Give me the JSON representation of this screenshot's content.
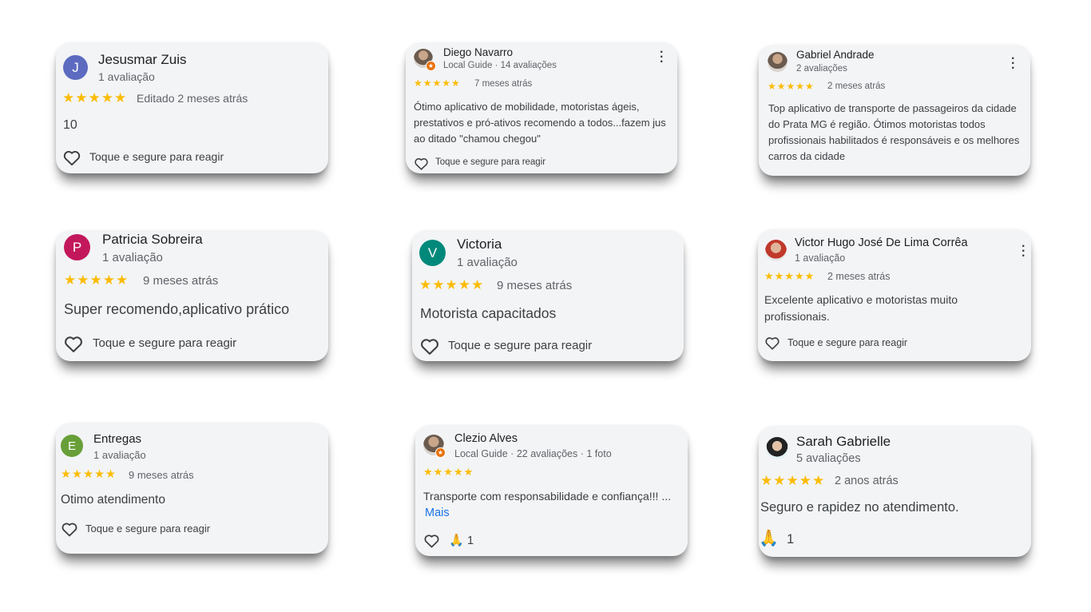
{
  "reaction_hint": "Toque e segure para reagir",
  "reviews": [
    {
      "avatar_letter": "J",
      "avatar_color": "#5c6bc0",
      "name": "Jesusmar Zuis",
      "meta": "1 avaliação",
      "stars": "★★★★★",
      "date": "Editado 2 meses atrás",
      "text": "10"
    },
    {
      "name": "Diego Navarro",
      "meta": "Local Guide · 14 avaliações",
      "stars": "★★★★★",
      "date": "7 meses atrás",
      "text": "Ótimo aplicativo de mobilidade, motoristas ágeis, prestativos e pró-ativos recomendo a todos...fazem jus ao ditado \"chamou chegou\"",
      "menu_icon": "more-vert-icon"
    },
    {
      "name": "Gabriel Andrade",
      "meta": "2 avaliações",
      "stars": "★★★★★",
      "date": "2 meses atrás",
      "text": "Top aplicativo de transporte de passageiros da cidade do Prata MG é região. Ótimos motoristas todos profissionais habilitados é responsáveis e os melhores carros da cidade",
      "menu_icon": "more-vert-icon"
    },
    {
      "avatar_letter": "P",
      "avatar_color": "#c2185b",
      "name": "Patricia Sobreira",
      "meta": "1 avaliação",
      "stars": "★★★★★",
      "date": "9 meses atrás",
      "text": "Super recomendo,aplicativo prático"
    },
    {
      "avatar_letter": "V",
      "avatar_color": "#00897b",
      "name": "Victoria",
      "meta": "1 avaliação",
      "stars": "★★★★★",
      "date": "9 meses atrás",
      "text": "Motorista capacitados"
    },
    {
      "name": "Victor Hugo José De Lima Corrêa",
      "meta": "1 avaliação",
      "stars": "★★★★★",
      "date": "2 meses atrás",
      "text": "Excelente aplicativo e motoristas muito profissionais.",
      "menu_icon": "more-vert-icon"
    },
    {
      "avatar_letter": "E",
      "avatar_color": "#689f38",
      "name": "Entregas",
      "meta": "1 avaliação",
      "stars": "★★★★★",
      "date": "9 meses atrás",
      "text": "Otimo atendimento"
    },
    {
      "name": "Clezio Alves",
      "meta": "Local Guide · 22 avaliações · 1 foto",
      "stars": "★★★★★",
      "date": "",
      "text": "Transporte com responsabilidade e confiança!!! ...",
      "more": "Mais",
      "reaction_count": "1"
    },
    {
      "name": "Sarah Gabrielle",
      "meta": "5 avaliações",
      "stars": "★★★★★",
      "date": "2 anos atrás",
      "text": "Seguro e rapidez no atendimento.",
      "reaction_count": "1"
    }
  ]
}
